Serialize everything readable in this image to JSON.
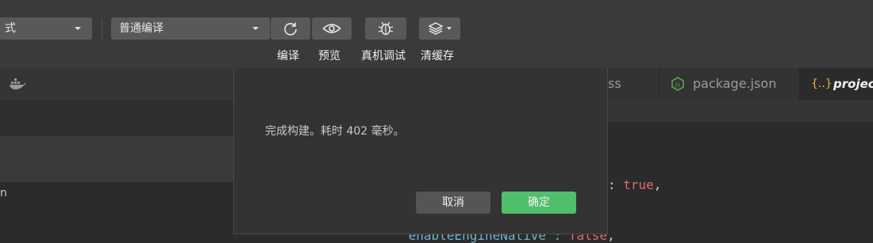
{
  "toolbar": {
    "mode_select_value": "式",
    "compile_select_value": "普通编译",
    "labels": {
      "compile": "编译",
      "preview": "预览",
      "debug": "真机调试",
      "clear_cache": "清缓存"
    }
  },
  "tabs": [
    {
      "label": "ss",
      "icon": "css-icon"
    },
    {
      "label": "package.json",
      "icon": "nodejs-icon"
    },
    {
      "label": "project",
      "icon": "json-braces-icon"
    }
  ],
  "left_panel": {
    "partial_label": "n"
  },
  "editor": {
    "lines": [
      {
        "text": ": ",
        "value": "true",
        "suffix": ","
      },
      {
        "text": "\"enableEngineNative\": ",
        "value": "false",
        "suffix": ","
      }
    ]
  },
  "dialog": {
    "message": "完成构建。耗时 402 毫秒。",
    "cancel_label": "取消",
    "ok_label": "确定"
  },
  "colors": {
    "toolbar_bg": "#3a3a3a",
    "button_bg": "#595959",
    "ok_green": "#4fbf6a",
    "cancel_gray": "#555555",
    "code_keyword": "#e06c6c",
    "code_key": "#6fb3d2"
  }
}
